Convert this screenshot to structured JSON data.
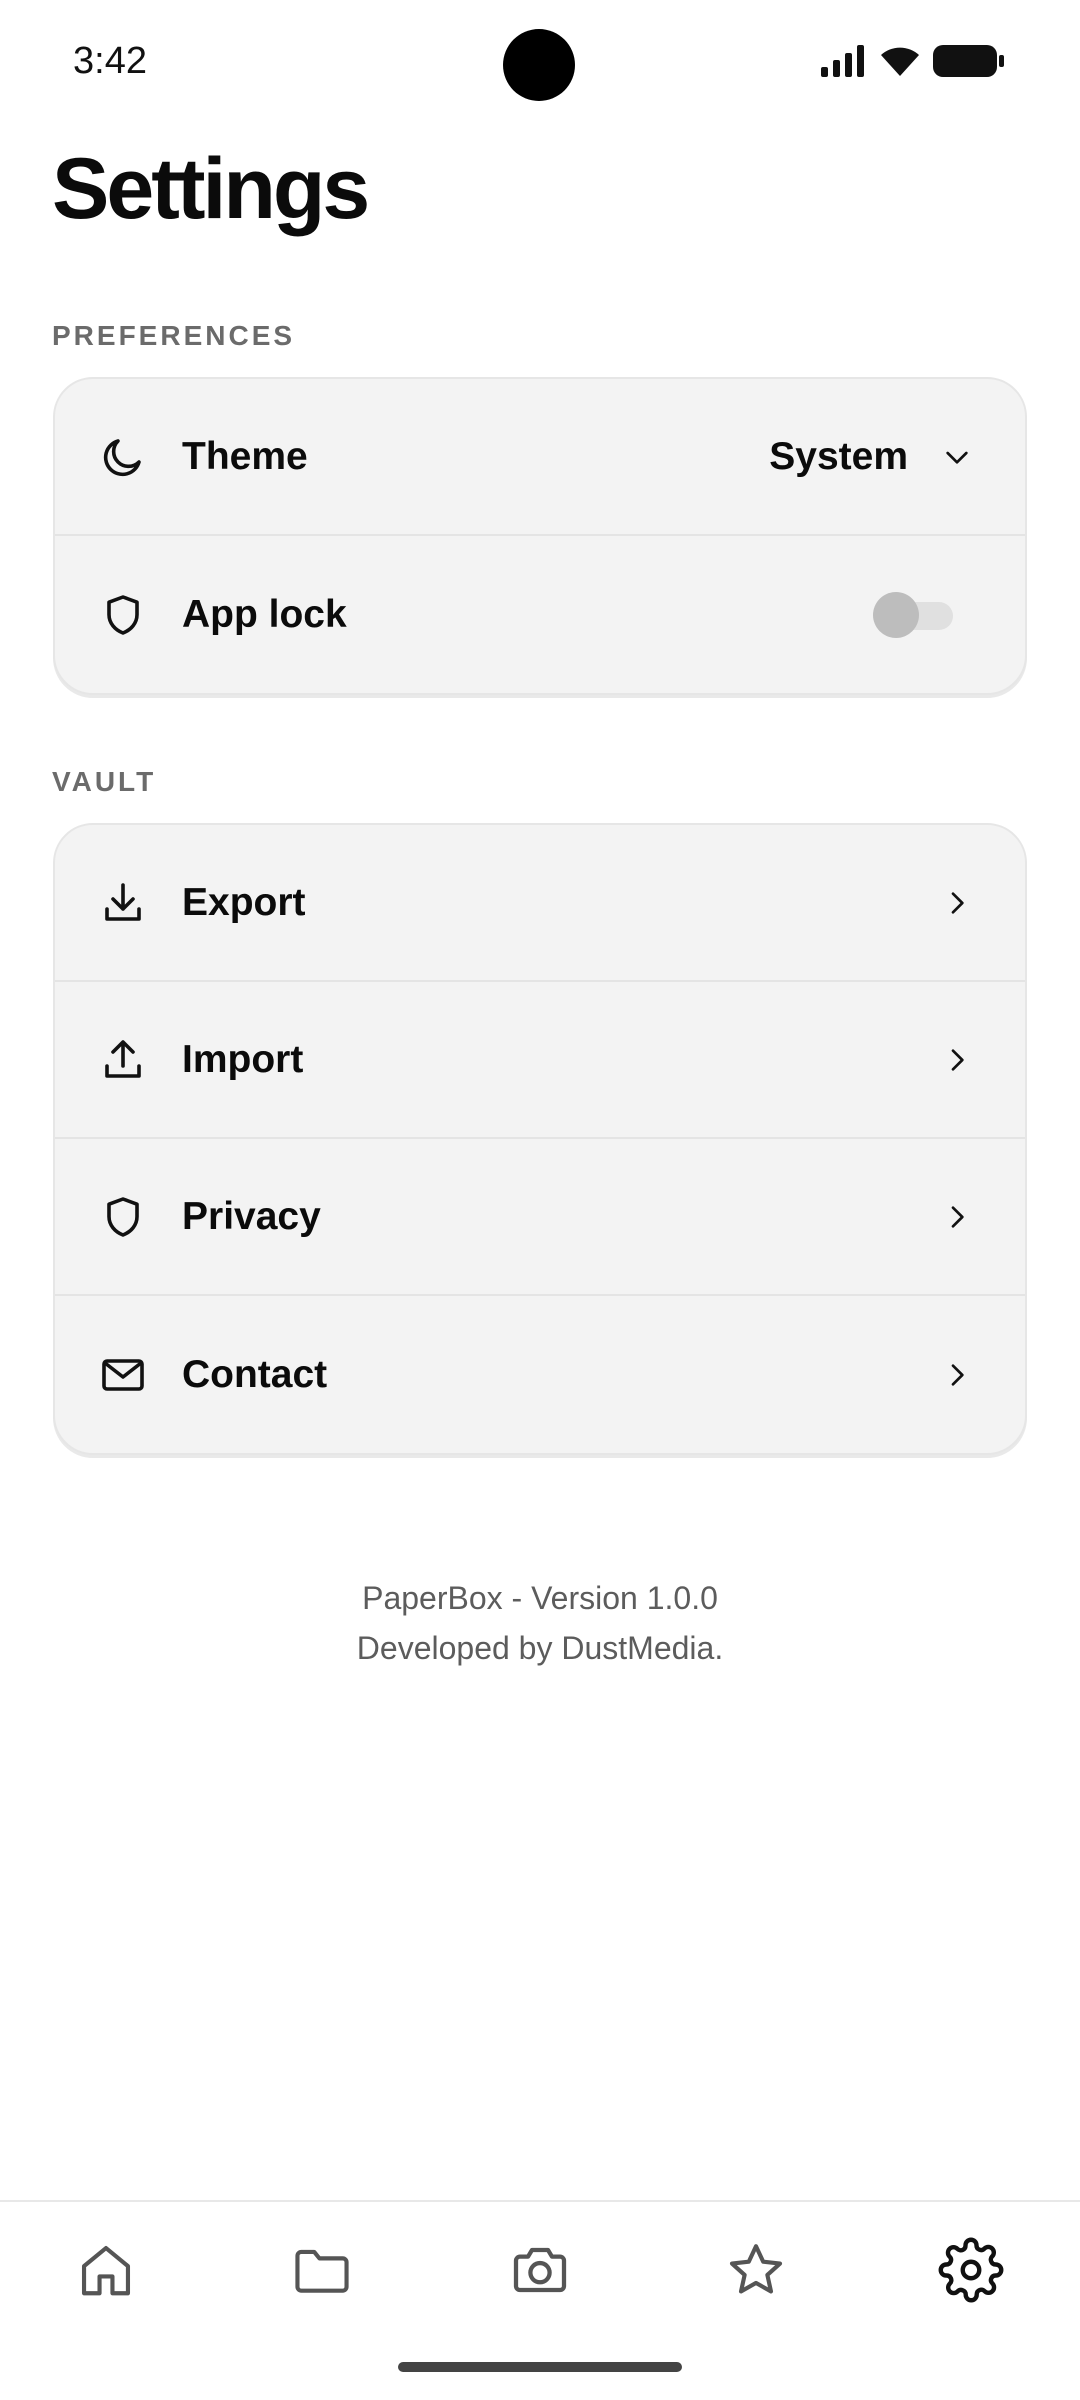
{
  "status_bar": {
    "time": "3:42"
  },
  "header": {
    "title": "Settings"
  },
  "sections": [
    {
      "label": "PREFERENCES",
      "items": [
        {
          "label": "Theme",
          "icon": "moon-icon",
          "value": "System",
          "control": "dropdown"
        },
        {
          "label": "App lock",
          "icon": "shield-icon",
          "control": "toggle",
          "enabled": false
        }
      ]
    },
    {
      "label": "VAULT",
      "items": [
        {
          "label": "Export",
          "icon": "download-icon",
          "control": "chevron"
        },
        {
          "label": "Import",
          "icon": "upload-icon",
          "control": "chevron"
        },
        {
          "label": "Privacy",
          "icon": "shield-icon",
          "control": "chevron"
        },
        {
          "label": "Contact",
          "icon": "mail-icon",
          "control": "chevron"
        }
      ]
    }
  ],
  "footer": {
    "version": "PaperBox - Version 1.0.0",
    "developer": "Developed by DustMedia."
  },
  "bottom_nav": {
    "items": [
      {
        "icon": "home-icon",
        "active": false
      },
      {
        "icon": "folder-icon",
        "active": false
      },
      {
        "icon": "camera-icon",
        "active": false
      },
      {
        "icon": "star-icon",
        "active": false
      },
      {
        "icon": "gear-icon",
        "active": true
      }
    ]
  },
  "colors": {
    "background": "#ffffff",
    "card": "#f3f3f3",
    "text": "#0b0b0b",
    "section_label": "#6b6b6b",
    "icon_inactive": "#555555",
    "icon_active": "#111111"
  }
}
